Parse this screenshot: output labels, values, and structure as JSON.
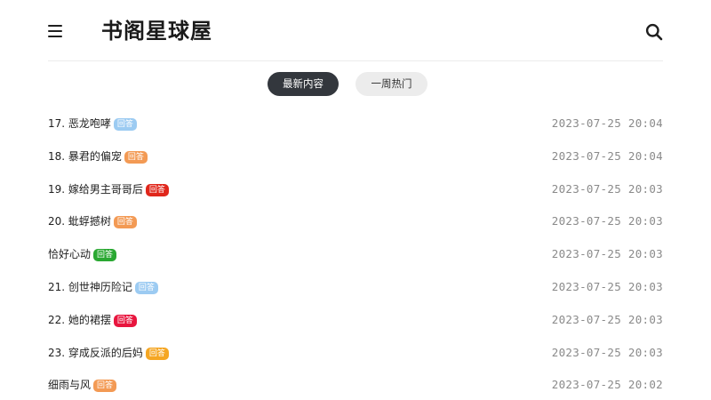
{
  "header": {
    "title": "书阁星球屋",
    "menu_icon": "hamburger-menu-icon",
    "search_icon": "search-icon"
  },
  "tabs": [
    {
      "label": "最新内容",
      "active": true
    },
    {
      "label": "一周热门",
      "active": false
    }
  ],
  "posts": [
    {
      "title": "17. 恶龙咆哮",
      "badge": "回答",
      "badge_color": "#9ccbf2",
      "time": "2023-07-25 20:04"
    },
    {
      "title": "18. 暴君的偏宠",
      "badge": "回答",
      "badge_color": "#f39a54",
      "time": "2023-07-25 20:04"
    },
    {
      "title": "19. 嫁给男主哥哥后",
      "badge": "回答",
      "badge_color": "#e0261b",
      "time": "2023-07-25 20:03"
    },
    {
      "title": "20. 蚍蜉撼树",
      "badge": "回答",
      "badge_color": "#f39a54",
      "time": "2023-07-25 20:03"
    },
    {
      "title": "恰好心动",
      "badge": "回答",
      "badge_color": "#2aa832",
      "time": "2023-07-25 20:03"
    },
    {
      "title": "21. 创世神历险记",
      "badge": "回答",
      "badge_color": "#9ccbf2",
      "time": "2023-07-25 20:03"
    },
    {
      "title": "22. 她的裙摆",
      "badge": "回答",
      "badge_color": "#e8153e",
      "time": "2023-07-25 20:03"
    },
    {
      "title": "23. 穿成反派的后妈",
      "badge": "回答",
      "badge_color": "#f5a623",
      "time": "2023-07-25 20:03"
    },
    {
      "title": "细雨与风",
      "badge": "回答",
      "badge_color": "#f39a54",
      "time": "2023-07-25 20:02"
    }
  ]
}
